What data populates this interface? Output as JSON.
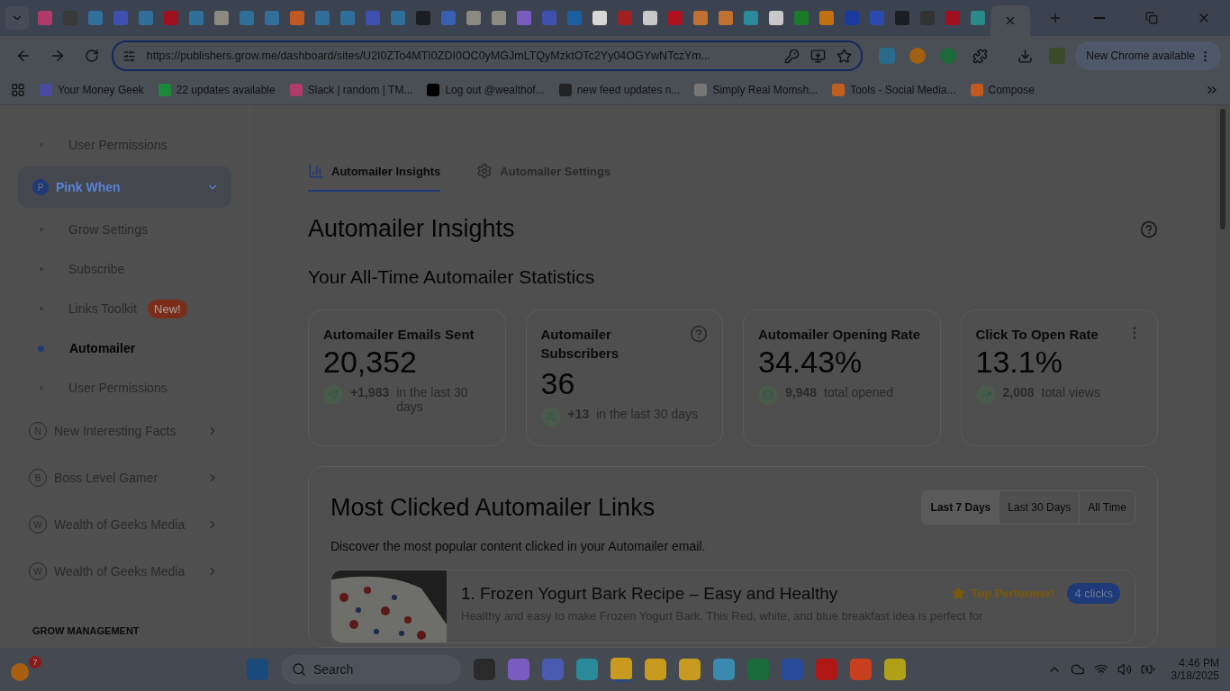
{
  "browser": {
    "tabs": [
      {
        "color": "#b03a6a",
        "selected": false
      },
      {
        "color": "#3a3a3a",
        "selected": false
      },
      {
        "color": "#2f6f9a",
        "selected": false
      },
      {
        "color": "#3f4fb0",
        "selected": false
      },
      {
        "color": "#2f6f9a",
        "selected": false
      },
      {
        "color": "#a0101e",
        "selected": false
      },
      {
        "color": "#2f6f9a",
        "selected": false
      },
      {
        "color": "#8a8a80",
        "selected": false
      },
      {
        "color": "#2f6f9a",
        "selected": false
      },
      {
        "color": "#2f6f9a",
        "selected": false
      },
      {
        "color": "#c05a20",
        "selected": false
      },
      {
        "color": "#2f6f9a",
        "selected": false
      },
      {
        "color": "#2f6f9a",
        "selected": false
      },
      {
        "color": "#3f4fb0",
        "selected": false
      },
      {
        "color": "#2f6f9a",
        "selected": false
      },
      {
        "color": "#1a1e22",
        "selected": false
      },
      {
        "color": "#3a5fb0",
        "selected": false
      },
      {
        "color": "#8a8a80",
        "selected": false
      },
      {
        "color": "#8a8a80",
        "selected": false
      },
      {
        "color": "#7a5bc0",
        "selected": false
      },
      {
        "color": "#3f4fb0",
        "selected": false
      },
      {
        "color": "#1a5fa0",
        "selected": false
      },
      {
        "color": "#d8d8d8",
        "selected": false
      },
      {
        "color": "#a02020",
        "selected": false
      },
      {
        "color": "#c8c8c8",
        "selected": false
      },
      {
        "color": "#b01020",
        "selected": false
      },
      {
        "color": "#c07030",
        "selected": false
      },
      {
        "color": "#c07030",
        "selected": false
      },
      {
        "color": "#2a8a9a",
        "selected": false
      },
      {
        "color": "#c8c8c8",
        "selected": false
      },
      {
        "color": "#1a7a2a",
        "selected": false
      },
      {
        "color": "#c07010",
        "selected": false
      },
      {
        "color": "#1a3aa0",
        "selected": false
      },
      {
        "color": "#2a4ab0",
        "selected": false
      },
      {
        "color": "#1a1e22",
        "selected": false
      },
      {
        "color": "#333333",
        "selected": false
      },
      {
        "color": "#a0101e",
        "selected": false
      },
      {
        "color": "#2a8a8a",
        "selected": false
      },
      {
        "selected": true
      }
    ],
    "url": "https://publishers.grow.me/dashboard/sites/U2I0ZTo4MTI0ZDI0OC0yMGJmLTQyMzktOTc2Yy04OGYwNTczYm...",
    "update_button": "New Chrome available",
    "bookmarks": [
      {
        "label": "Your Money Geek",
        "color": "#4a4aa0"
      },
      {
        "label": "22 updates available",
        "color": "#1a8a3a"
      },
      {
        "label": "Slack | random | TM...",
        "color": "#b03a6a"
      },
      {
        "label": "Log out @wealthof...",
        "color": "#000000"
      },
      {
        "label": "new feed updates n...",
        "color": "#222222"
      },
      {
        "label": "Simply Real Momsh...",
        "color": "#777777"
      },
      {
        "label": "Tools - Social Media...",
        "color": "#c06020"
      },
      {
        "label": "Compose",
        "color": "#c05a20"
      }
    ]
  },
  "sidebar": {
    "items": [
      {
        "kind": "sub",
        "label": "User Permissions",
        "selected": false
      },
      {
        "kind": "site",
        "initial": "P",
        "label": "Pink When",
        "expanded": true
      },
      {
        "kind": "sub",
        "label": "Grow Settings",
        "selected": false
      },
      {
        "kind": "sub",
        "label": "Subscribe",
        "selected": false
      },
      {
        "kind": "sub",
        "label": "Links Toolkit",
        "badge": "New!",
        "selected": false
      },
      {
        "kind": "sub",
        "label": "Automailer",
        "selected": true
      },
      {
        "kind": "sub",
        "label": "User Permissions",
        "selected": false
      },
      {
        "kind": "site",
        "initial": "N",
        "label": "New Interesting Facts",
        "expanded": false
      },
      {
        "kind": "site",
        "initial": "B",
        "label": "Boss Level Gamer",
        "expanded": false
      },
      {
        "kind": "site",
        "initial": "W",
        "label": "Wealth of Geeks Media",
        "expanded": false
      },
      {
        "kind": "site",
        "initial": "W",
        "label": "Wealth of Geeks Media",
        "expanded": false
      }
    ],
    "section": "GROW MANAGEMENT"
  },
  "page_tabs": [
    {
      "kind": "insights",
      "label": "Automailer Insights",
      "selected": true
    },
    {
      "kind": "settings",
      "label": "Automailer Settings",
      "selected": false
    }
  ],
  "title": "Automailer Insights",
  "subtitle": "Your All-Time Automailer Statistics",
  "stats": [
    {
      "kind": "sent",
      "title": "Automailer Emails Sent",
      "value": "20,352",
      "delta": "+1,983",
      "note": "in the last 30 days",
      "help": false,
      "menu": false
    },
    {
      "kind": "subscribers",
      "title": "Automailer Subscribers",
      "value": "36",
      "delta": "+13",
      "note": "in the last 30 days",
      "help": true,
      "menu": false
    },
    {
      "kind": "opened",
      "title": "Automailer Opening Rate",
      "value": "34.43%",
      "delta": "9,948",
      "note": "total opened",
      "help": false,
      "menu": false
    },
    {
      "kind": "views",
      "title": "Click To Open Rate",
      "value": "13.1%",
      "delta": "2,008",
      "note": "total views",
      "help": false,
      "menu": true
    }
  ],
  "links": {
    "title": "Most Clicked Automailer Links",
    "ranges": [
      {
        "label": "Last 7 Days",
        "selected": true
      },
      {
        "label": "Last 30 Days",
        "selected": false
      },
      {
        "label": "All Time",
        "selected": false
      }
    ],
    "description": "Discover the most popular content clicked in your Automailer email.",
    "items": [
      {
        "kind": "picture",
        "title": "1. Frozen Yogurt Bark Recipe – Easy and Healthy",
        "tag": "Top Performer!",
        "clicks": "4 clicks",
        "excerpt": "Healthy and easy to make Frozen Yogurt Bark. This Red, white, and blue breakfast idea is perfect for"
      }
    ]
  },
  "taskbar": {
    "weather_badge": "7",
    "search": "Search",
    "apps": [
      {
        "color": "#2a2a2a",
        "selected": false
      },
      {
        "color": "#7a5bc0",
        "selected": false
      },
      {
        "color": "#4a5ab0",
        "selected": false
      },
      {
        "color": "#2a8a9a",
        "selected": false
      },
      {
        "color": "#c89a20",
        "selected": true
      },
      {
        "color": "#c89a20",
        "selected": false
      },
      {
        "color": "#c89a20",
        "selected": false
      },
      {
        "color": "#3a8ab0",
        "selected": false
      },
      {
        "color": "#1a6a3a",
        "selected": false
      },
      {
        "color": "#2a4a9a",
        "selected": false
      },
      {
        "color": "#b01818",
        "selected": false
      },
      {
        "color": "#c84020",
        "selected": false
      },
      {
        "color": "#b0a018",
        "selected": false
      }
    ],
    "time": "4:46 PM",
    "date": "3/18/2025"
  }
}
